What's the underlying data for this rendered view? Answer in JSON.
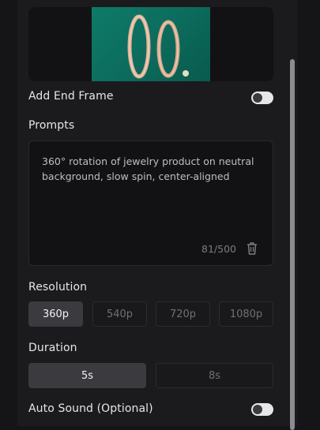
{
  "add_end_frame": {
    "label": "Add End Frame",
    "enabled": false
  },
  "prompts": {
    "label": "Prompts",
    "text": "360° rotation of jewelry product on neutral background, slow spin, center-aligned",
    "counter": "81/500"
  },
  "resolution": {
    "label": "Resolution",
    "options": [
      "360p",
      "540p",
      "720p",
      "1080p"
    ],
    "selected": "360p"
  },
  "duration": {
    "label": "Duration",
    "options": [
      "5s",
      "8s"
    ],
    "selected": "5s"
  },
  "auto_sound": {
    "label": "Auto Sound (Optional)",
    "enabled": false
  },
  "colors": {
    "background": "#151518",
    "panel": "#1b1b1e",
    "thumbnail": "#0b6b5c",
    "selected": "#3a3a3f"
  },
  "icons": [
    "trash-icon"
  ]
}
